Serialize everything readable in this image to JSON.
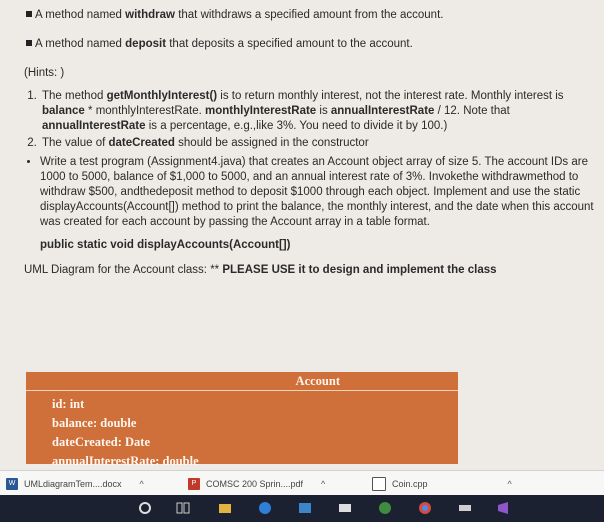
{
  "doc": {
    "bullet1_pre": "A method named ",
    "bullet1_bold": "withdraw",
    "bullet1_post": " that withdraws a specified amount from the account.",
    "bullet2_pre": "A method named ",
    "bullet2_bold": "deposit",
    "bullet2_post": " that deposits a specified amount to the account.",
    "hints": "(Hints: )",
    "hint1_a": "The method ",
    "hint1_b": "getMonthlyInterest()",
    "hint1_c": " is to return monthly interest, not the interest rate. Monthly interest is ",
    "hint1_d": "balance",
    "hint1_e": " * monthlyInterestRate. ",
    "hint1_f": "monthlyInterestRate",
    "hint1_g": " is ",
    "hint1_h": "annualInterestRate",
    "hint1_i": " / 12. Note that ",
    "hint1_j": "annualInterestRate",
    "hint1_k": " is a percentage, e.g.,like 3%. You need to divide it by 100.)",
    "hint2_a": "The value of ",
    "hint2_b": "dateCreated",
    "hint2_c": " should be assigned in the constructor",
    "task": "Write a test program (Assignment4.java) that creates an Account object array of size 5. The account IDs are 1000 to 5000, balance of $1,000 to 5000, and an annual interest rate of 3%. Invokethe withdrawmethod to withdraw $500, andthedeposit method to deposit $1000 through each object. Implement and use the static displayAccounts(Account[]) method to print the balance, the monthly interest, and the date when this account was created for each account by passing the Account array in a table format.",
    "signature": "public static void displayAccounts(Account[])",
    "uml_pre": "UML Diagram for the Account class: ** ",
    "uml_req": "PLEASE USE it to design and implement the class"
  },
  "uml_class": {
    "name": "Account",
    "attributes": [
      "id: int",
      "balance: double",
      "dateCreated: Date",
      "annualInterestRate: double"
    ],
    "box_color": "#cf6f3a"
  },
  "downloads": [
    {
      "name": "UMLdiagramTem....docx",
      "icon": "word-icon",
      "color": "#2b5797"
    },
    {
      "name": "COMSC 200 Sprin....pdf",
      "icon": "pdf-icon",
      "color": "#c0392b"
    },
    {
      "name": "Coin.cpp",
      "icon": "file-icon",
      "color": "#555555"
    }
  ],
  "taskbar": {
    "background": "#1b2130"
  }
}
